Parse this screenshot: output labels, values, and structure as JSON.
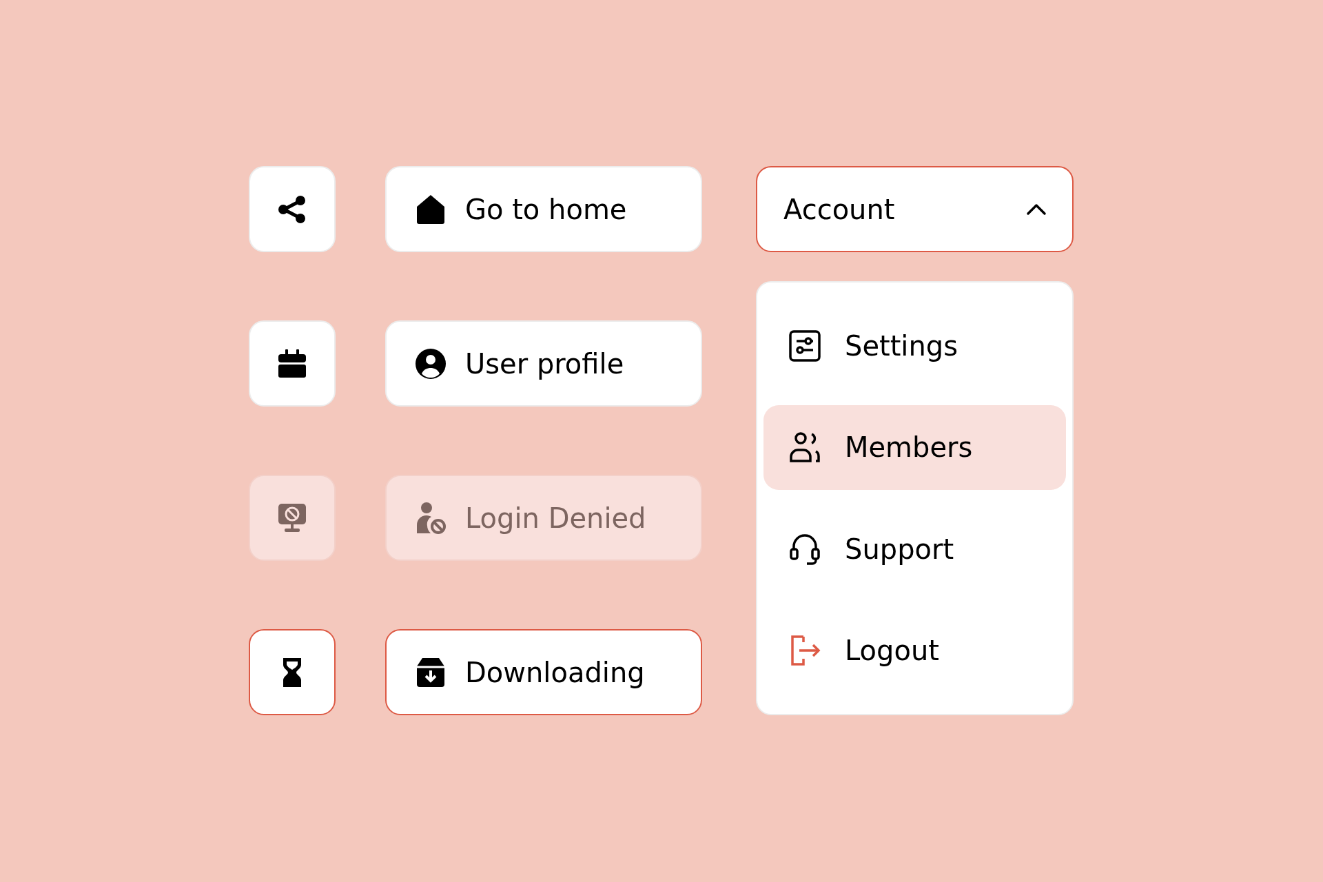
{
  "icon_buttons": [
    {
      "kind": "share",
      "disabled": false,
      "focused": false
    },
    {
      "kind": "calendar",
      "disabled": false,
      "focused": false
    },
    {
      "kind": "blocked-monitor",
      "disabled": true,
      "focused": false
    },
    {
      "kind": "hourglass",
      "disabled": false,
      "focused": true
    }
  ],
  "buttons": [
    {
      "label": "Go to home",
      "kind": "home",
      "disabled": false,
      "focused": false
    },
    {
      "label": "User profile",
      "kind": "user",
      "disabled": false,
      "focused": false
    },
    {
      "label": "Login Denied",
      "kind": "user-blocked",
      "disabled": true,
      "focused": false
    },
    {
      "label": "Downloading",
      "kind": "download-box",
      "disabled": false,
      "focused": true
    }
  ],
  "dropdown": {
    "label": "Account",
    "expanded": true,
    "focused": true,
    "items": [
      {
        "label": "Settings",
        "kind": "settings",
        "selected": false,
        "danger": false
      },
      {
        "label": "Members",
        "kind": "members",
        "selected": true,
        "danger": false
      },
      {
        "label": "Support",
        "kind": "support",
        "selected": false,
        "danger": false
      },
      {
        "label": "Logout",
        "kind": "logout",
        "selected": false,
        "danger": true
      }
    ]
  }
}
